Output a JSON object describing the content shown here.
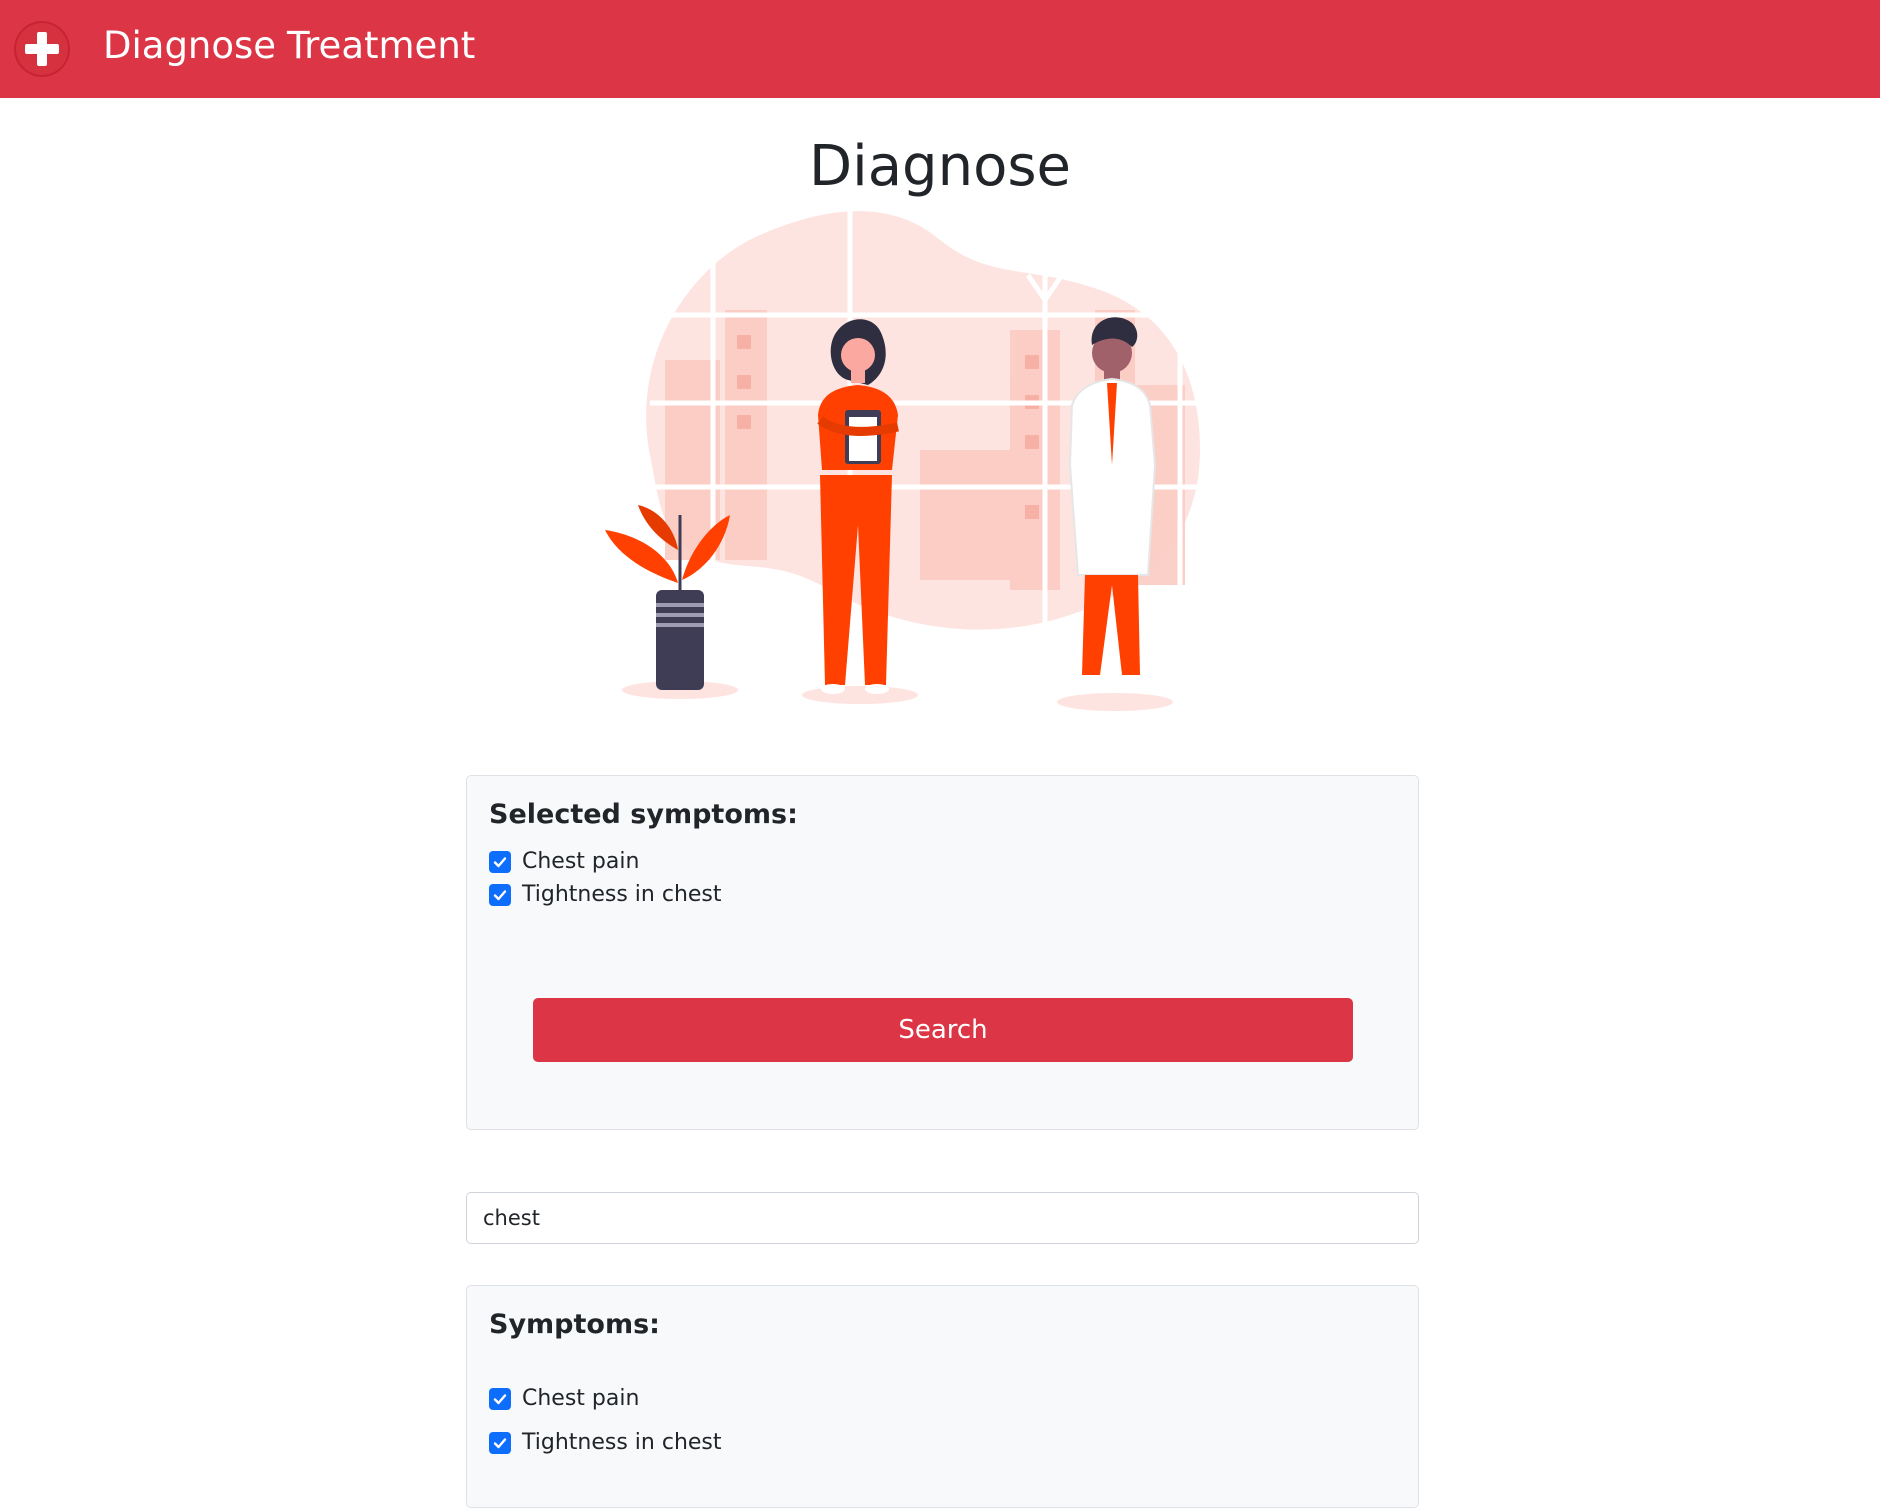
{
  "navbar": {
    "logo_icon": "medical-cross-icon",
    "links": [
      "Diagnose",
      "Treatment"
    ],
    "color": "#dc3545"
  },
  "page": {
    "title": "Diagnose"
  },
  "illustration": {
    "name": "medical-staff-illustration"
  },
  "selected_symptoms": {
    "heading": "Selected symptoms:",
    "items": [
      {
        "label": "Chest pain",
        "checked": true
      },
      {
        "label": "Tightness in chest",
        "checked": true
      }
    ],
    "button_label": "Search"
  },
  "search": {
    "value": "chest"
  },
  "symptoms": {
    "heading": "Symptoms:",
    "items": [
      {
        "label": "Chest pain",
        "checked": true
      },
      {
        "label": "Tightness in chest",
        "checked": true
      }
    ]
  },
  "colors": {
    "accent": "#dc3545",
    "checkbox": "#0d6efd",
    "card_bg": "#f8f9fa"
  }
}
